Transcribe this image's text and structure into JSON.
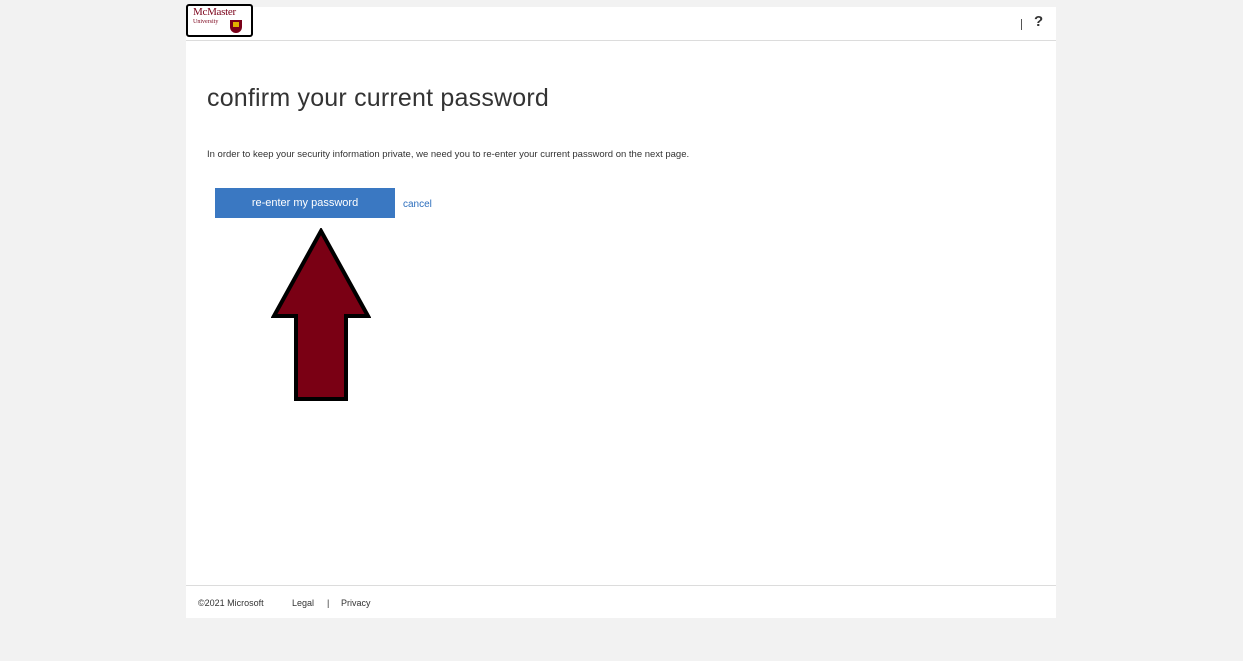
{
  "header": {
    "logo_name": "McMaster",
    "logo_sub": "University",
    "help_icon": "?",
    "divider": "|"
  },
  "main": {
    "title": "confirm your current password",
    "description": "In order to keep your security information private, we need you to re-enter your current password on the next page.",
    "primary_button": "re-enter my password",
    "cancel_link": "cancel"
  },
  "annotation": {
    "icon": "up-arrow-icon",
    "color": "#7a0014"
  },
  "footer": {
    "copyright": "©2021 Microsoft",
    "legal": "Legal",
    "separator": "|",
    "privacy": "Privacy"
  },
  "colors": {
    "accent": "#3a78c2",
    "link": "#2c6ebd",
    "background": "#f2f2f2"
  }
}
